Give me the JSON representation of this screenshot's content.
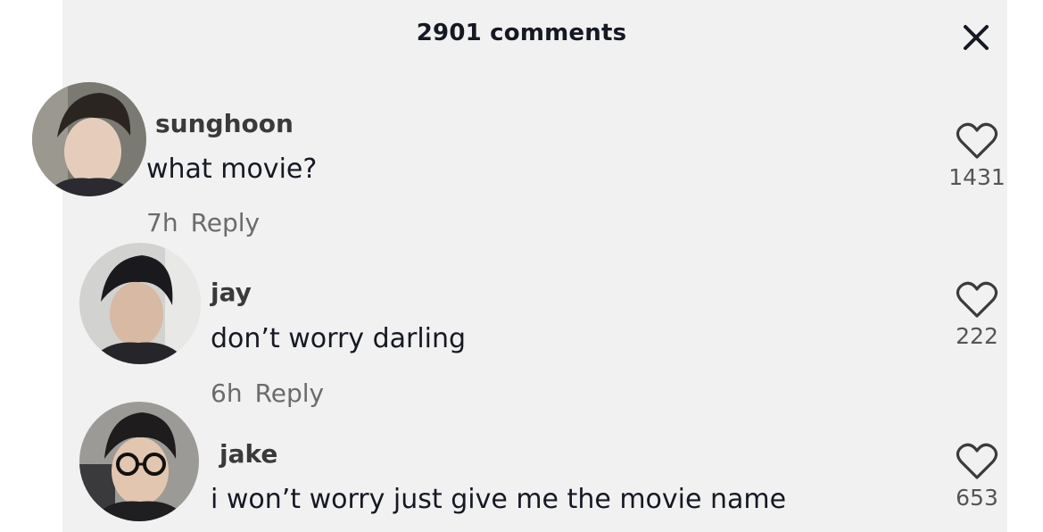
{
  "header": {
    "title": "2901 comments",
    "close_icon": "close-icon"
  },
  "comments": [
    {
      "username": "sunghoon",
      "text": "what movie?",
      "time": "7h",
      "reply_label": "Reply",
      "likes": "1431"
    },
    {
      "username": "jay",
      "text": "don’t worry darling",
      "time": "6h",
      "reply_label": "Reply",
      "likes": "222"
    },
    {
      "username": "jake",
      "text": "i won’t worry just give me the movie name",
      "likes": "653"
    }
  ],
  "colors": {
    "background": "#f1f1f1",
    "text": "#161823",
    "muted": "#6b6b6b"
  }
}
